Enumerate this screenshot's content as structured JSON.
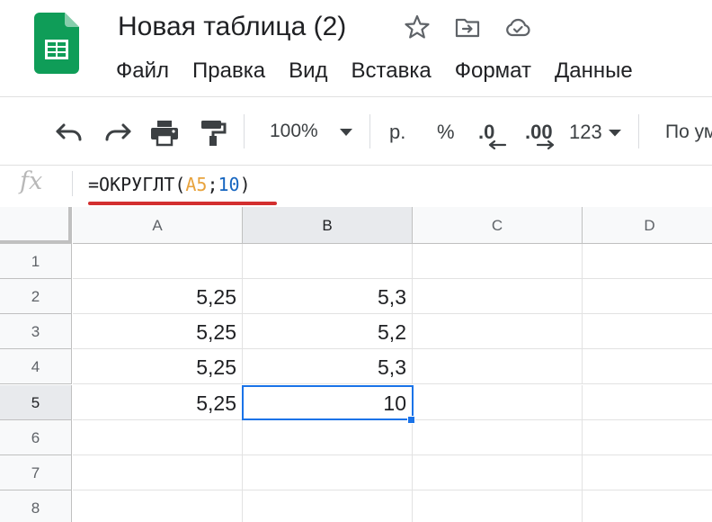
{
  "app": {
    "document_title": "Новая таблица (2)",
    "header_icons": [
      "star-icon",
      "move-to-folder-icon",
      "cloud-saved-icon"
    ]
  },
  "menu": {
    "items": [
      "Файл",
      "Правка",
      "Вид",
      "Вставка",
      "Формат",
      "Данные"
    ]
  },
  "toolbar": {
    "buttons": [
      "undo-icon",
      "redo-icon",
      "print-icon",
      "paint-format-icon"
    ],
    "zoom": "100%",
    "currency": "р.",
    "percent": "%",
    "decrease_decimals": ".0",
    "increase_decimals": ".00",
    "more_formats": "123",
    "font_label": "По ум"
  },
  "formula_bar": {
    "fx_label": "fx",
    "formula": {
      "prefix": "=ОКРУГЛТ(",
      "ref": "A5",
      "separator": ";",
      "number": "10",
      "suffix": ")"
    },
    "highlight_color": "#d32f2f"
  },
  "grid": {
    "columns": [
      "A",
      "B",
      "C",
      "D"
    ],
    "active_column": "B",
    "active_row": 5,
    "selected_cell": "B5",
    "rows": [
      {
        "num": "1",
        "cells": [
          "",
          "",
          "",
          ""
        ]
      },
      {
        "num": "2",
        "cells": [
          "5,25",
          "5,3",
          "",
          ""
        ]
      },
      {
        "num": "3",
        "cells": [
          "5,25",
          "5,2",
          "",
          ""
        ]
      },
      {
        "num": "4",
        "cells": [
          "5,25",
          "5,3",
          "",
          ""
        ]
      },
      {
        "num": "5",
        "cells": [
          "5,25",
          "10",
          "",
          ""
        ]
      },
      {
        "num": "6",
        "cells": [
          "",
          "",
          "",
          ""
        ]
      },
      {
        "num": "7",
        "cells": [
          "",
          "",
          "",
          ""
        ]
      },
      {
        "num": "8",
        "cells": [
          "",
          "",
          "",
          ""
        ]
      }
    ]
  },
  "colors": {
    "sheets_green": "#0f9d58",
    "selection_blue": "#1a73e8",
    "ref_orange": "#e8a33d",
    "number_blue": "#1565c0"
  }
}
